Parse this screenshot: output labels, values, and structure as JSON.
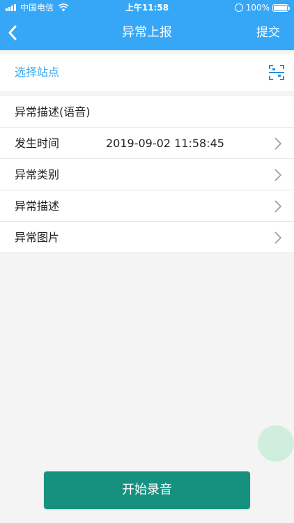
{
  "status_bar": {
    "carrier": "中国电信",
    "time": "上午11:58",
    "battery_percent": "100%",
    "battery_level": 1.0
  },
  "nav": {
    "title": "异常上报",
    "submit_label": "提交",
    "back_icon": "chevron-left-icon"
  },
  "station": {
    "label": "选择站点",
    "scan_icon": "qr-scan-icon"
  },
  "rows": [
    {
      "label": "异常描述(语音)",
      "value": "",
      "has_chevron": false
    },
    {
      "label": "发生时间",
      "value": "2019-09-02 11:58:45",
      "has_chevron": true
    },
    {
      "label": "异常类别",
      "value": "",
      "has_chevron": true
    },
    {
      "label": "异常描述",
      "value": "",
      "has_chevron": true
    },
    {
      "label": "异常图片",
      "value": "",
      "has_chevron": true
    }
  ],
  "record_button": {
    "label": "开始录音"
  },
  "colors": {
    "header": "#36a7f6",
    "accent_text": "#36a7f6",
    "record_button": "#16917f",
    "float_circle": "#cfeedd",
    "background": "#f4f4f4"
  }
}
